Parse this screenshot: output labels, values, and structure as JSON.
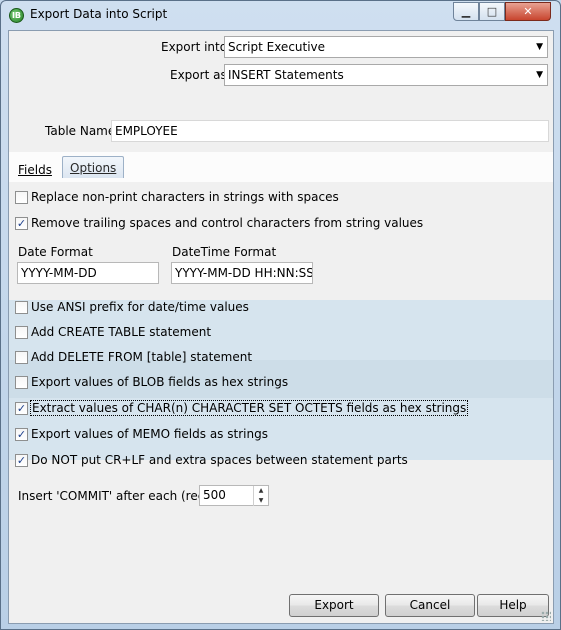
{
  "window": {
    "title": "Export Data into Script"
  },
  "form": {
    "export_into_label": "Export into",
    "export_into_value": "Script Executive",
    "export_as_label": "Export as",
    "export_as_value": "INSERT Statements",
    "table_name_label": "Table Name",
    "table_name_value": "EMPLOYEE"
  },
  "tabs": {
    "fields": "Fields",
    "options": "Options",
    "active": "Fields"
  },
  "options": [
    {
      "label": "Replace non-print characters in strings with spaces",
      "checked": false
    },
    {
      "label": "Remove trailing spaces and control characters from string values",
      "checked": true
    },
    {
      "label": "Use ANSI prefix for date/time values",
      "checked": false
    },
    {
      "label": "Add CREATE TABLE statement",
      "checked": false
    },
    {
      "label": "Add DELETE FROM [table] statement",
      "checked": false
    },
    {
      "label": "Export values of BLOB fields as hex strings",
      "checked": false
    },
    {
      "label": "Extract values of CHAR(n) CHARACTER SET OCTETS fields as hex strings",
      "checked": true
    },
    {
      "label": "Export values of MEMO fields as strings",
      "checked": true
    },
    {
      "label": "Do NOT put CR+LF and extra spaces between statement parts",
      "checked": true
    }
  ],
  "formats": {
    "date_label": "Date Format",
    "date_value": "YYYY-MM-DD",
    "datetime_label": "DateTime Format",
    "datetime_value": "YYYY-MM-DD HH:NN:SS"
  },
  "commit": {
    "label": "Insert 'COMMIT' after each (recor",
    "value": "500"
  },
  "buttons": {
    "export": "Export",
    "cancel": "Cancel",
    "help": "Help"
  },
  "colors": {
    "band_light": "#d6e4ee",
    "band_dark": "#cddde8",
    "panel": "#f0f0f0"
  }
}
